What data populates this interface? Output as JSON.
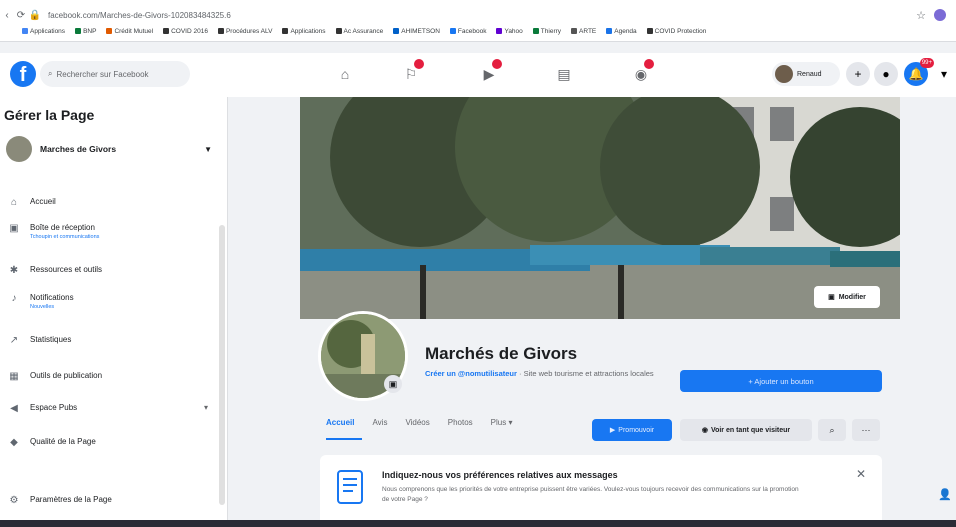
{
  "browser": {
    "url": "facebook.com/Marches-de-Givors-102083484325.6",
    "bookmarks": [
      "Applications",
      "BNP",
      "Crédit Mutuel",
      "COVID 2016",
      "Procédures ALV",
      "Applications",
      "Ac Assurance",
      "AHIMETSON",
      "Facebook",
      "Yahoo",
      "Thierry",
      "ARTE",
      "Agenda",
      "COVID Protection"
    ]
  },
  "facebook": {
    "search_placeholder": "Rechercher sur Facebook",
    "user_name": "Renaud",
    "notif_badge": "99+"
  },
  "sidebar": {
    "title": "Gérer la Page",
    "page_name": "Marches de Givors",
    "items": [
      {
        "label": "Accueil",
        "sub": ""
      },
      {
        "label": "Boîte de réception",
        "sub": "Tchoupin et communications"
      },
      {
        "label": "Ressources et outils",
        "sub": ""
      },
      {
        "label": "Notifications",
        "sub": "Nouvelles"
      },
      {
        "label": "Statistiques",
        "sub": ""
      },
      {
        "label": "Outils de publication",
        "sub": ""
      },
      {
        "label": "Espace Pubs",
        "sub": ""
      },
      {
        "label": "Qualité de la Page",
        "sub": ""
      },
      {
        "label": "Paramètres de la Page",
        "sub": ""
      }
    ]
  },
  "cover": {
    "edit_label": "Modifier"
  },
  "profile": {
    "name": "Marchés de Givors",
    "username_prompt": "Créer un @nomutilisateur",
    "category": "· Site web tourisme et attractions locales",
    "add_button": "+ Ajouter un bouton"
  },
  "tabs": [
    "Accueil",
    "Avis",
    "Vidéos",
    "Photos",
    "Plus ▾"
  ],
  "actions": {
    "promote": "Promouvoir",
    "view_as_visitor": "Voir en tant que visiteur"
  },
  "message_card": {
    "title": "Indiquez-nous vos préférences relatives aux messages",
    "body": "Nous comprenons que les priorités de votre entreprise puissent être variées. Voulez-vous toujours recevoir des communications sur la promotion de votre Page ?"
  }
}
